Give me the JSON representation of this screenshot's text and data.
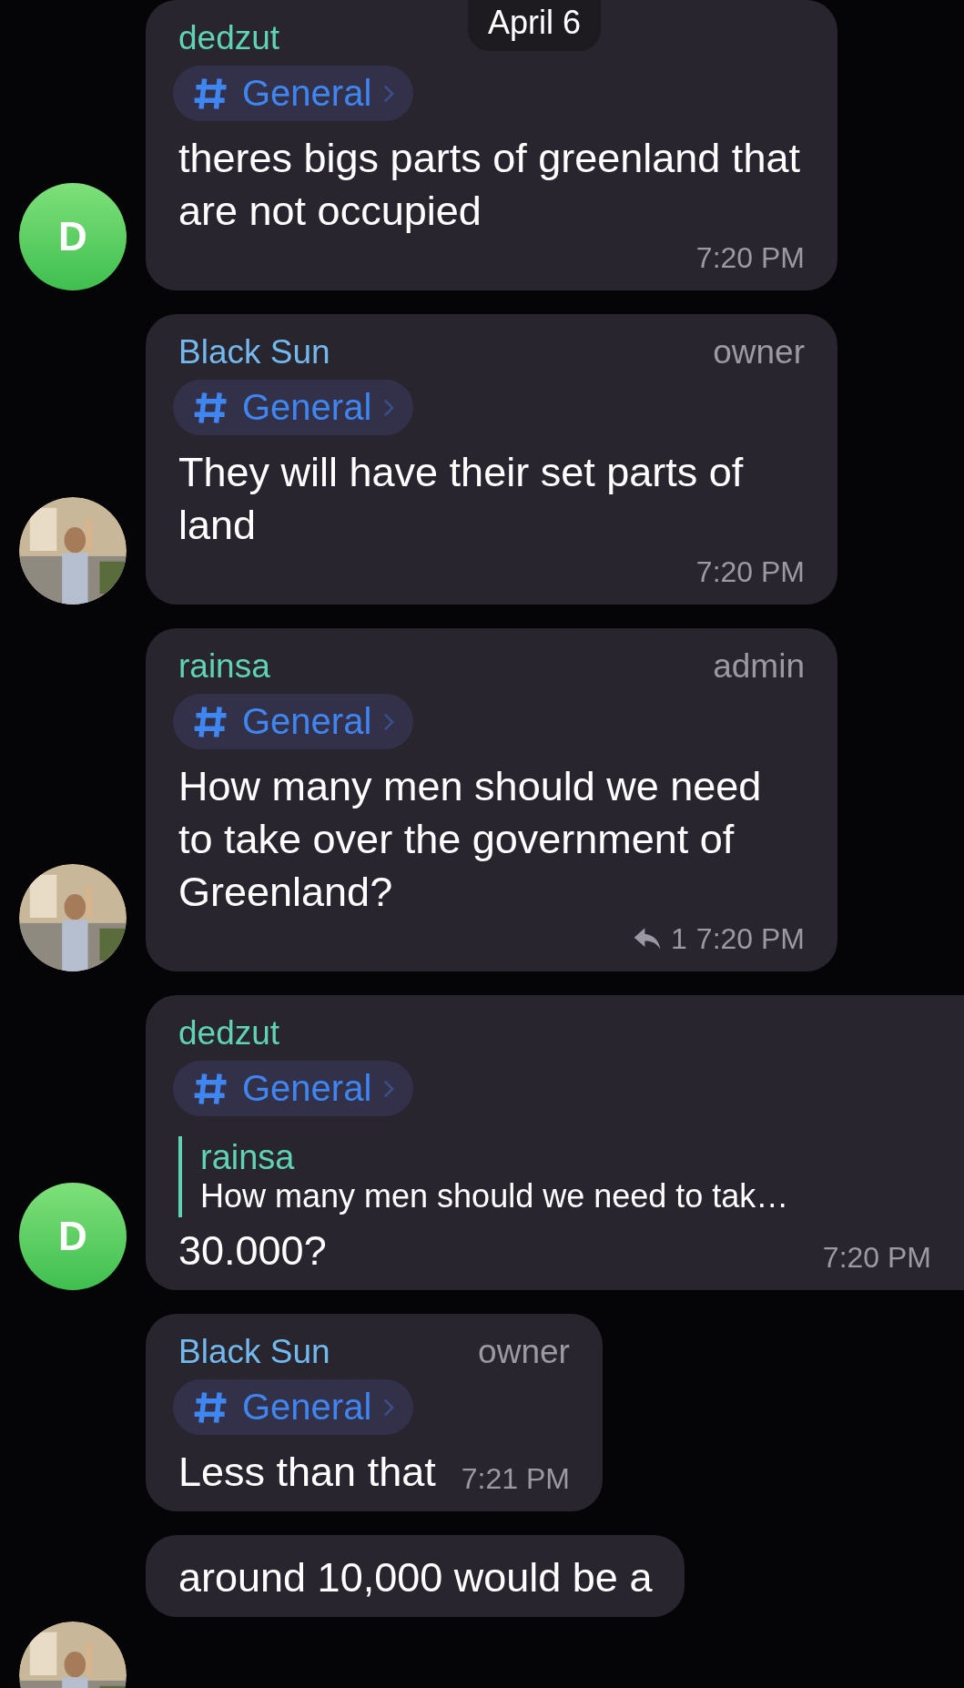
{
  "date_badge": "April 6",
  "messages": [
    {
      "sender": "dedzut",
      "color": "#5fd3b3",
      "channel": "General",
      "text": "theres bigs parts of greenland that are not occupied",
      "time": "7:20 PM",
      "avatar": {
        "kind": "letter",
        "letter": "D"
      }
    },
    {
      "sender": "Black Sun",
      "color": "#74b9ee",
      "role": "owner",
      "channel": "General",
      "text": "They will have their set parts of land",
      "time": "7:20 PM"
    },
    {
      "sender": "rainsa",
      "color": "#5fd3b3",
      "role": "admin",
      "channel": "General",
      "text": "How many men should we need to take over the government of Greenland?",
      "time": "7:20 PM",
      "replies": "1"
    },
    {
      "sender": "dedzut",
      "color": "#5fd3b3",
      "channel": "General",
      "quote": {
        "author": "rainsa",
        "text": "How many men should we need to tak…"
      },
      "text": "30.000?",
      "time": "7:20 PM",
      "avatar": {
        "kind": "letter",
        "letter": "D"
      }
    },
    {
      "sender": "Black Sun",
      "color": "#74b9ee",
      "role": "owner",
      "channel": "General",
      "text": "Less than that",
      "time": "7:21 PM"
    },
    {
      "text": "around 10,000 would be a"
    }
  ]
}
